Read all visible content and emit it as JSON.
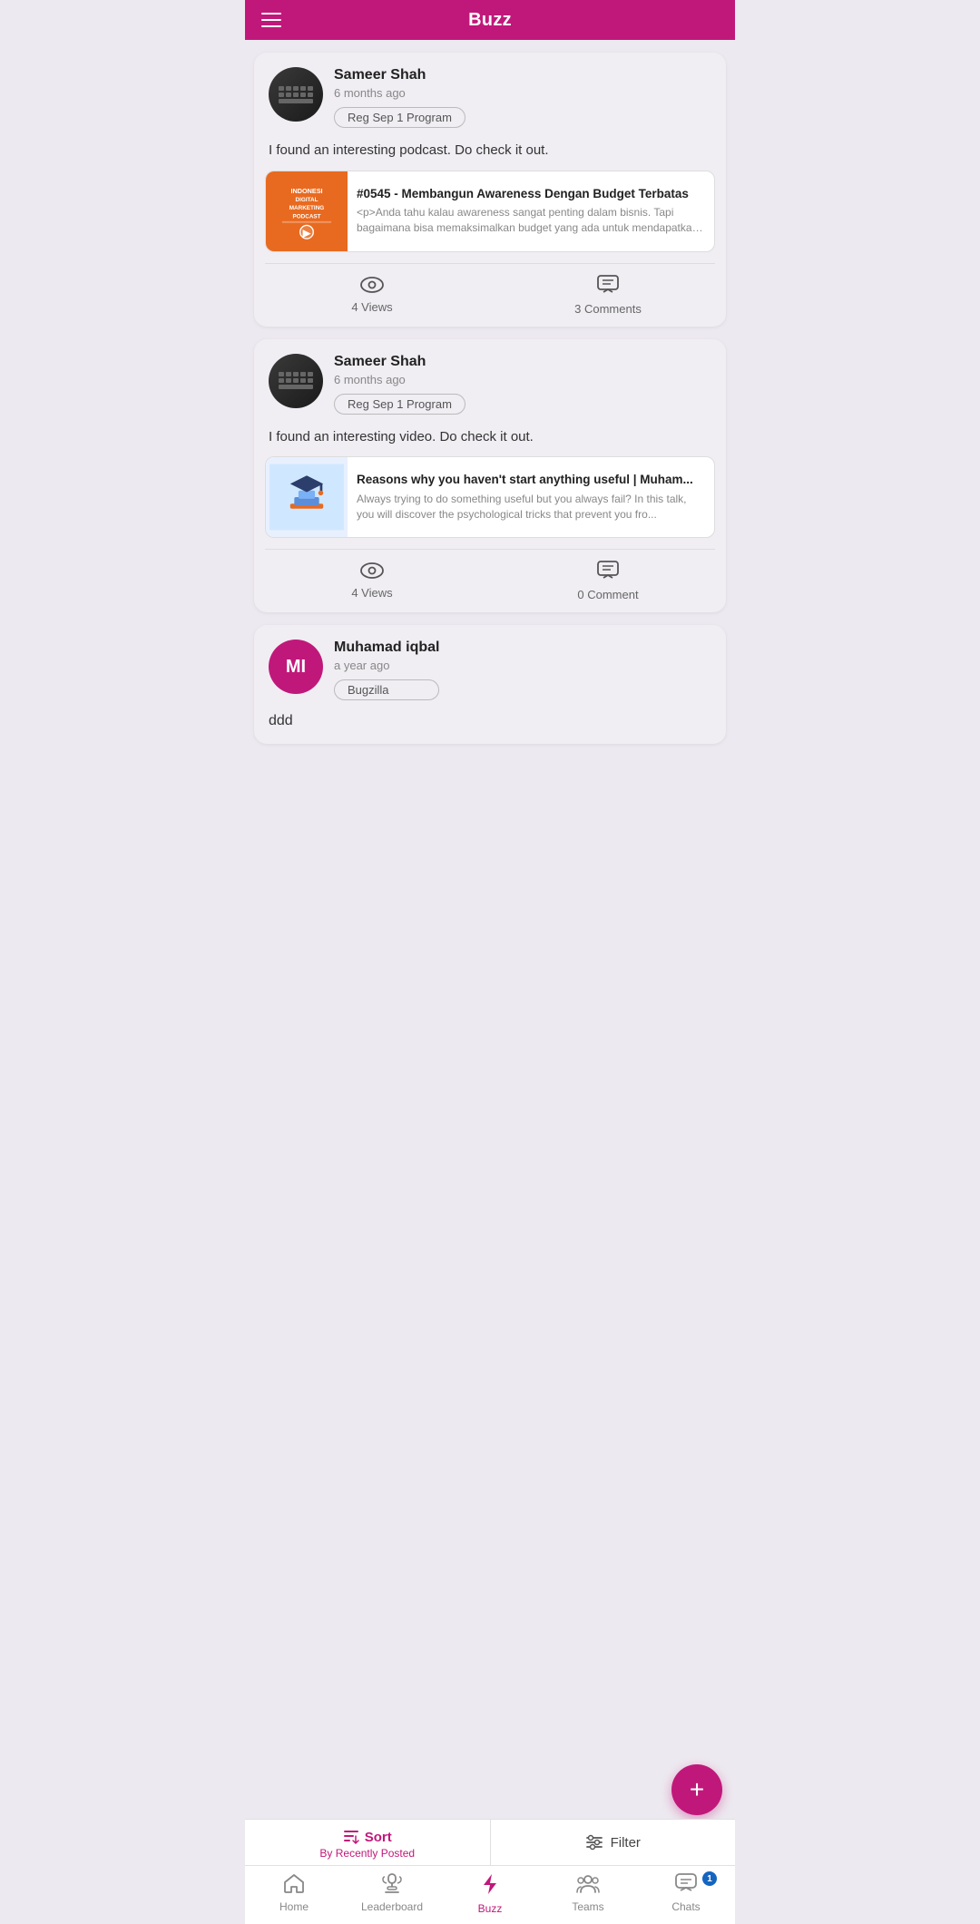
{
  "header": {
    "title": "Buzz"
  },
  "posts": [
    {
      "id": "post1",
      "author": "Sameer  Shah",
      "time": "6 months ago",
      "tag": "Reg Sep 1 Program",
      "body": "I found an interesting podcast. Do check it out.",
      "link": {
        "title": "#0545 - Membangun Awareness Dengan Budget Terbatas",
        "desc": "<p>Anda tahu kalau awareness sangat penting dalam bisnis. Tapi bagaimana bisa memaksimalkan budget yang ada untuk mendapatkan j...",
        "thumbnail_type": "podcast"
      },
      "views": "4 Views",
      "comments": "3 Comments",
      "avatar_type": "keyboard"
    },
    {
      "id": "post2",
      "author": "Sameer  Shah",
      "time": "6 months ago",
      "tag": "Reg Sep 1 Program",
      "body": "I found an interesting video. Do check it out.",
      "link": {
        "title": "Reasons why you haven't start anything useful  | Muham...",
        "desc": "Always trying to do something useful but you always fail?\nIn this talk, you will discover the psychological tricks that prevent you fro...",
        "thumbnail_type": "video"
      },
      "views": "4 Views",
      "comments": "0 Comment",
      "avatar_type": "keyboard"
    },
    {
      "id": "post3",
      "author": "Muhamad  iqbal",
      "time": "a year ago",
      "tag": "Bugzilla",
      "body": "ddd",
      "link": null,
      "avatar_type": "initials",
      "initials": "MI",
      "avatar_color": "#c0187a"
    }
  ],
  "sort": {
    "label": "Sort",
    "sub_label": "By Recently Posted"
  },
  "filter": {
    "label": "Filter"
  },
  "nav": {
    "items": [
      {
        "label": "Home",
        "icon": "home",
        "active": false
      },
      {
        "label": "Leaderboard",
        "icon": "leaderboard",
        "active": false
      },
      {
        "label": "Buzz",
        "icon": "buzz",
        "active": true
      },
      {
        "label": "Teams",
        "icon": "teams",
        "active": false
      },
      {
        "label": "Chats",
        "icon": "chats",
        "active": false,
        "badge": "1"
      }
    ]
  },
  "fab": {
    "label": "+"
  }
}
